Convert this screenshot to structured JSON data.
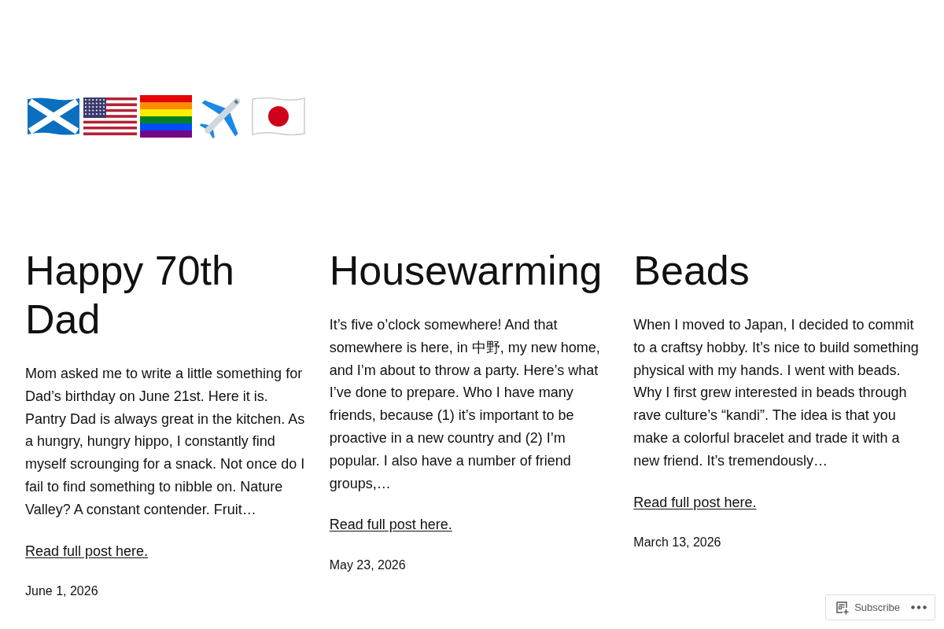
{
  "header": {
    "emoji": [
      {
        "kind": "saltire"
      },
      {
        "kind": "stripes"
      },
      {
        "kind": "rainbow"
      },
      {
        "kind": "airplane"
      },
      {
        "kind": "disc"
      }
    ]
  },
  "posts": [
    {
      "title": "Happy 70th Dad",
      "excerpt": "Mom asked me to write a little something for Dad’s birthday on June 21st. Here it is. Pantry Dad is always great in the kitchen. As a hungry, hungry hippo, I constantly find myself scrounging for a snack. Not once do I fail to find something to nibble on. Nature Valley? A constant contender. Fruit…",
      "link": "Read full post here.",
      "date": "June 1, 2026"
    },
    {
      "title": "Housewarming",
      "excerpt": "It’s five o’clock somewhere! And that somewhere is here, in 中野, my new home, and I’m about to throw a party. Here’s what I’ve done to prepare. Who I have many friends, because (1) it’s important to be proactive in a new country and (2) I’m popular. I also have a number of friend groups,…",
      "link": "Read full post here.",
      "date": "May 23, 2026"
    },
    {
      "title": "Beads",
      "excerpt": "When I moved to Japan, I decided to commit to a craftsy hobby. It’s nice to build something physical with my hands. I went with beads. Why I first grew interested in beads through rave culture’s “kandi”. The idea is that you make a colorful bracelet and trade it with a new friend. It’s tremendously…",
      "link": "Read full post here.",
      "date": "March 13, 2026"
    }
  ],
  "subscribe_bar": {
    "label": "Subscribe"
  }
}
